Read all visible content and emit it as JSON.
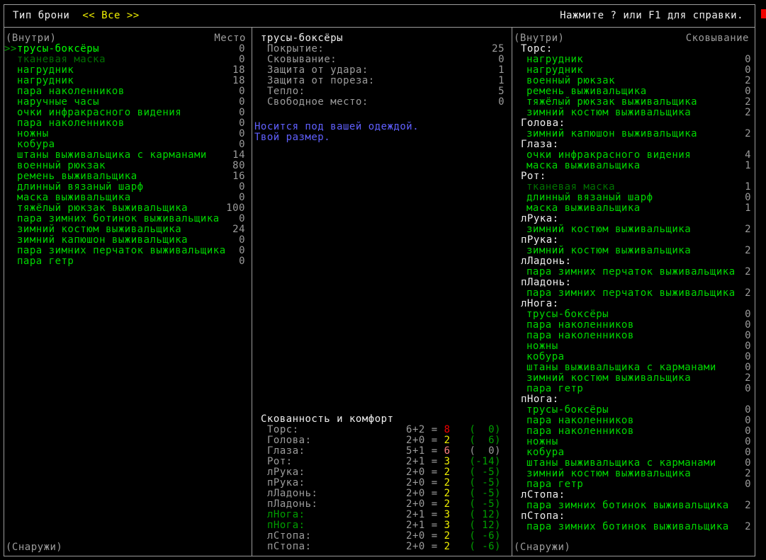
{
  "colors": {
    "background": "#000000",
    "border": "#9c9c9c",
    "white": "#f0f0f0",
    "gray": "#9c9c9c",
    "yellow": "#f0f000",
    "red": "#f00000",
    "pink": "#ff8080",
    "blue": "#6060ff",
    "green": "#00d800",
    "green_bright": "#00ff00",
    "green_mid": "#00a000",
    "green_dim": "#007000"
  },
  "top_bar": {
    "title": "Тип брони",
    "filter": "<< Все >>",
    "help": "Нажмите ? или F1 для справки."
  },
  "left_panel": {
    "header_left": "(Внутри)",
    "header_right": "Место",
    "footer": "(Снаружи)",
    "selection_marker": ">>",
    "items": [
      {
        "name": "трусы-боксёры",
        "value": "0",
        "state": "selected"
      },
      {
        "name": "тканевая маска",
        "value": "0",
        "state": "dim"
      },
      {
        "name": "нагрудник",
        "value": "18",
        "state": "normal"
      },
      {
        "name": "нагрудник",
        "value": "18",
        "state": "normal"
      },
      {
        "name": "пара наколенников",
        "value": "0",
        "state": "normal"
      },
      {
        "name": "наручные часы",
        "value": "0",
        "state": "normal"
      },
      {
        "name": "очки инфракрасного видения",
        "value": "0",
        "state": "normal"
      },
      {
        "name": "пара наколенников",
        "value": "0",
        "state": "normal"
      },
      {
        "name": "ножны",
        "value": "0",
        "state": "normal"
      },
      {
        "name": "кобура",
        "value": "0",
        "state": "normal"
      },
      {
        "name": "штаны выживальщика с карманами",
        "value": "14",
        "state": "normal"
      },
      {
        "name": "военный рюкзак",
        "value": "80",
        "state": "normal"
      },
      {
        "name": "ремень выживальщика",
        "value": "16",
        "state": "normal"
      },
      {
        "name": "длинный вязаный шарф",
        "value": "0",
        "state": "normal"
      },
      {
        "name": "маска выживальщика",
        "value": "0",
        "state": "normal"
      },
      {
        "name": "тяжёлый рюкзак выживальщика",
        "value": "100",
        "state": "normal"
      },
      {
        "name": "пара зимних ботинок выживальщика",
        "value": "0",
        "state": "normal"
      },
      {
        "name": "зимний костюм выживальщика",
        "value": "24",
        "state": "normal"
      },
      {
        "name": "зимний капюшон выживальщика",
        "value": "0",
        "state": "normal"
      },
      {
        "name": "пара зимних перчаток выживальщика",
        "value": "0",
        "state": "normal"
      },
      {
        "name": "пара гетр",
        "value": "0",
        "state": "normal"
      }
    ]
  },
  "middle_panel": {
    "title": "трусы-боксёры",
    "stats": [
      {
        "label": "Покрытие:",
        "value": "25"
      },
      {
        "label": "Сковывание:",
        "value": "0"
      },
      {
        "label": "Защита от удара:",
        "value": "1"
      },
      {
        "label": "Защита от пореза:",
        "value": "1"
      },
      {
        "label": "Тепло:",
        "value": "5"
      },
      {
        "label": "Свободное место:",
        "value": "0"
      }
    ],
    "description": [
      "Носится под вашей одеждой.",
      "Твой размер."
    ],
    "encumbrance": {
      "title": "Скованность и комфорт",
      "rows": [
        {
          "label": "Торс:",
          "label_color": "gray",
          "formula": "6+2",
          "total": "8",
          "total_color": "red",
          "extra": "(  0)",
          "extra_color": "green"
        },
        {
          "label": "Голова:",
          "label_color": "gray",
          "formula": "2+0",
          "total": "2",
          "total_color": "yellow",
          "extra": "(  6)",
          "extra_color": "green"
        },
        {
          "label": "Глаза:",
          "label_color": "gray",
          "formula": "5+1",
          "total": "6",
          "total_color": "pink",
          "extra": "(  0)",
          "extra_color": "gray"
        },
        {
          "label": "Рот:",
          "label_color": "gray",
          "formula": "2+1",
          "total": "3",
          "total_color": "yellow",
          "extra": "(-14)",
          "extra_color": "green"
        },
        {
          "label": "лРука:",
          "label_color": "gray",
          "formula": "2+0",
          "total": "2",
          "total_color": "yellow",
          "extra": "( -5)",
          "extra_color": "green"
        },
        {
          "label": "пРука:",
          "label_color": "gray",
          "formula": "2+0",
          "total": "2",
          "total_color": "yellow",
          "extra": "( -5)",
          "extra_color": "green"
        },
        {
          "label": "лЛадонь:",
          "label_color": "gray",
          "formula": "2+0",
          "total": "2",
          "total_color": "yellow",
          "extra": "( -5)",
          "extra_color": "green"
        },
        {
          "label": "пЛадонь:",
          "label_color": "gray",
          "formula": "2+0",
          "total": "2",
          "total_color": "yellow",
          "extra": "( -5)",
          "extra_color": "green"
        },
        {
          "label": "лНога:",
          "label_color": "green",
          "formula": "2+1",
          "total": "3",
          "total_color": "yellow",
          "extra": "( 12)",
          "extra_color": "green"
        },
        {
          "label": "пНога:",
          "label_color": "green",
          "formula": "2+1",
          "total": "3",
          "total_color": "yellow",
          "extra": "( 12)",
          "extra_color": "green"
        },
        {
          "label": "лСтопа:",
          "label_color": "gray",
          "formula": "2+0",
          "total": "2",
          "total_color": "yellow",
          "extra": "( -6)",
          "extra_color": "green"
        },
        {
          "label": "пСтопа:",
          "label_color": "gray",
          "formula": "2+0",
          "total": "2",
          "total_color": "yellow",
          "extra": "( -6)",
          "extra_color": "green"
        }
      ]
    }
  },
  "right_panel": {
    "header_left": "(Внутри)",
    "header_right": "Сковывание",
    "footer": "(Снаружи)",
    "groups": [
      {
        "label": "Торс:",
        "items": [
          {
            "name": "нагрудник",
            "value": "0",
            "state": "normal"
          },
          {
            "name": "нагрудник",
            "value": "0",
            "state": "normal"
          },
          {
            "name": "военный рюкзак",
            "value": "2",
            "state": "normal"
          },
          {
            "name": "ремень выживальщика",
            "value": "0",
            "state": "normal"
          },
          {
            "name": "тяжёлый рюкзак выживальщика",
            "value": "2",
            "state": "normal"
          },
          {
            "name": "зимний костюм выживальщика",
            "value": "2",
            "state": "normal"
          }
        ]
      },
      {
        "label": "Голова:",
        "items": [
          {
            "name": "зимний капюшон выживальщика",
            "value": "2",
            "state": "normal"
          }
        ]
      },
      {
        "label": "Глаза:",
        "items": [
          {
            "name": "очки инфракрасного видения",
            "value": "4",
            "state": "normal"
          },
          {
            "name": "маска выживальщика",
            "value": "1",
            "state": "normal"
          }
        ]
      },
      {
        "label": "Рот:",
        "items": [
          {
            "name": "тканевая маска",
            "value": "1",
            "state": "dim"
          },
          {
            "name": "длинный вязаный шарф",
            "value": "0",
            "state": "normal"
          },
          {
            "name": "маска выживальщика",
            "value": "1",
            "state": "normal"
          }
        ]
      },
      {
        "label": "лРука:",
        "items": [
          {
            "name": "зимний костюм выживальщика",
            "value": "2",
            "state": "normal"
          }
        ]
      },
      {
        "label": "пРука:",
        "items": [
          {
            "name": "зимний костюм выживальщика",
            "value": "2",
            "state": "normal"
          }
        ]
      },
      {
        "label": "лЛадонь:",
        "items": [
          {
            "name": "пара зимних перчаток выживальщика",
            "value": "2",
            "state": "normal"
          }
        ]
      },
      {
        "label": "пЛадонь:",
        "items": [
          {
            "name": "пара зимних перчаток выживальщика",
            "value": "2",
            "state": "normal"
          }
        ]
      },
      {
        "label": "лНога:",
        "items": [
          {
            "name": "трусы-боксёры",
            "value": "0",
            "state": "normal"
          },
          {
            "name": "пара наколенников",
            "value": "0",
            "state": "normal"
          },
          {
            "name": "пара наколенников",
            "value": "0",
            "state": "normal"
          },
          {
            "name": "ножны",
            "value": "0",
            "state": "normal"
          },
          {
            "name": "кобура",
            "value": "0",
            "state": "normal"
          },
          {
            "name": "штаны выживальщика с карманами",
            "value": "0",
            "state": "normal"
          },
          {
            "name": "зимний костюм выживальщика",
            "value": "2",
            "state": "normal"
          },
          {
            "name": "пара гетр",
            "value": "0",
            "state": "normal"
          }
        ]
      },
      {
        "label": "пНога:",
        "items": [
          {
            "name": "трусы-боксёры",
            "value": "0",
            "state": "normal"
          },
          {
            "name": "пара наколенников",
            "value": "0",
            "state": "normal"
          },
          {
            "name": "пара наколенников",
            "value": "0",
            "state": "normal"
          },
          {
            "name": "ножны",
            "value": "0",
            "state": "normal"
          },
          {
            "name": "кобура",
            "value": "0",
            "state": "normal"
          },
          {
            "name": "штаны выживальщика с карманами",
            "value": "0",
            "state": "normal"
          },
          {
            "name": "зимний костюм выживальщика",
            "value": "2",
            "state": "normal"
          },
          {
            "name": "пара гетр",
            "value": "0",
            "state": "normal"
          }
        ]
      },
      {
        "label": "лСтопа:",
        "items": [
          {
            "name": "пара зимних ботинок выживальщика",
            "value": "2",
            "state": "normal"
          }
        ]
      },
      {
        "label": "пСтопа:",
        "items": [
          {
            "name": "пара зимних ботинок выживальщика",
            "value": "2",
            "state": "normal"
          }
        ]
      }
    ]
  }
}
